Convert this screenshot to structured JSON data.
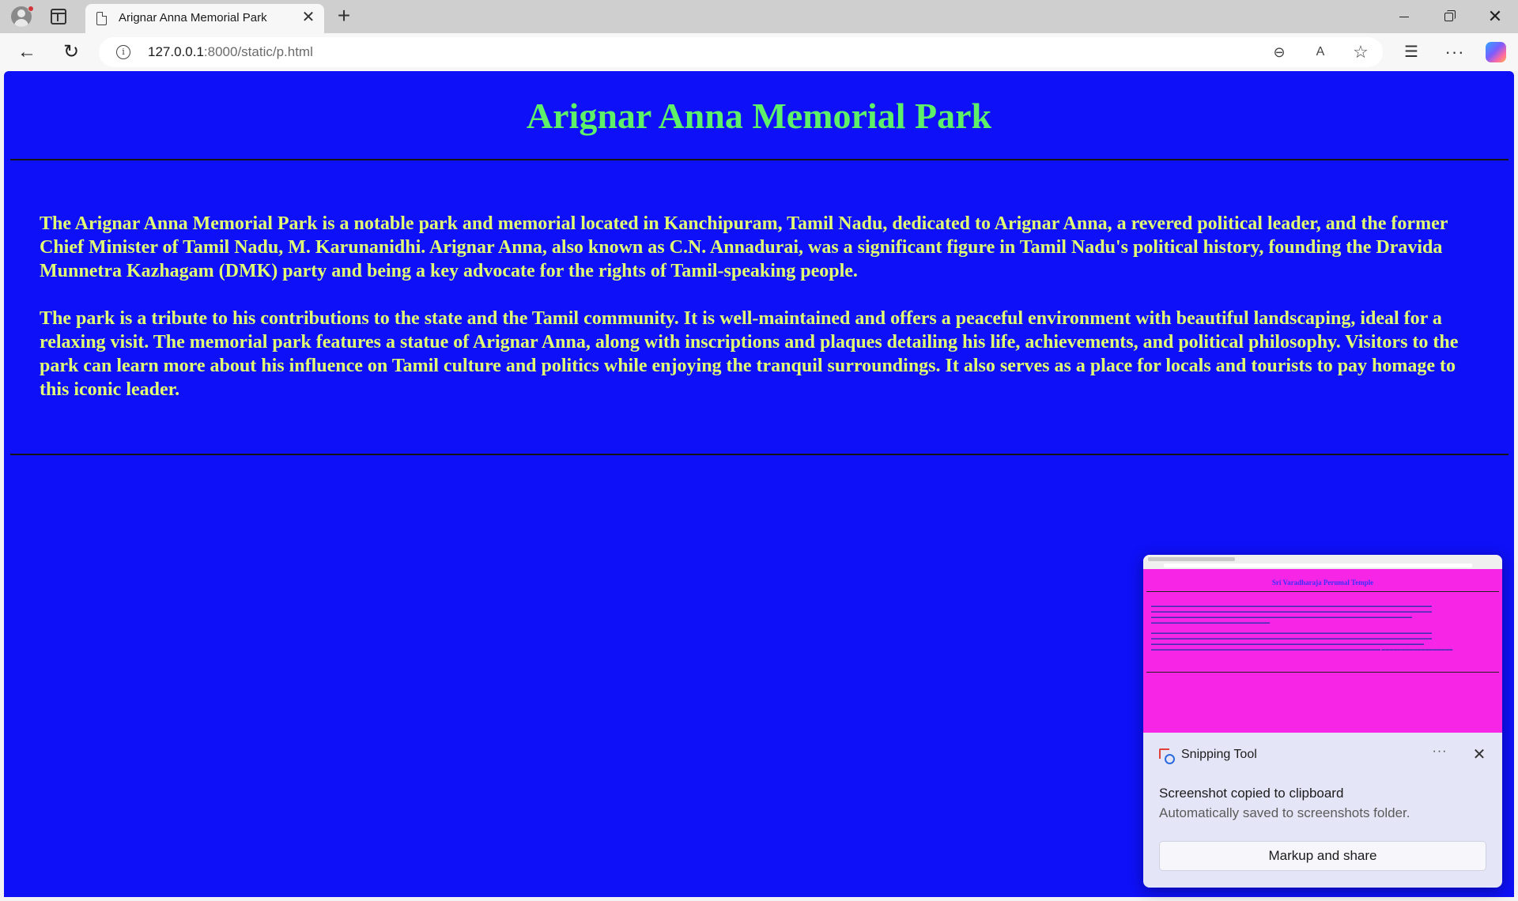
{
  "browser": {
    "tab": {
      "title": "Arignar Anna Memorial Park",
      "close": "✕"
    },
    "new_tab": "+",
    "url": {
      "host": "127.0.0.1",
      "path": ":8000/static/p.html"
    },
    "window_controls": {
      "close": "✕"
    }
  },
  "page": {
    "title": "Arignar Anna Memorial Park",
    "paragraphs": [
      "The Arignar Anna Memorial Park is a notable park and memorial located in Kanchipuram, Tamil Nadu, dedicated to Arignar Anna, a revered political leader, and the former Chief Minister of Tamil Nadu, M. Karunanidhi. Arignar Anna, also known as C.N. Annadurai, was a significant figure in Tamil Nadu's political history, founding the Dravida Munnetra Kazhagam (DMK) party and being a key advocate for the rights of Tamil-speaking people.",
      "The park is a tribute to his contributions to the state and the Tamil community. It is well-maintained and offers a peaceful environment with beautiful landscaping, ideal for a relaxing visit. The memorial park features a statue of Arignar Anna, along with inscriptions and plaques detailing his life, achievements, and political philosophy. Visitors to the park can learn more about his influence on Tamil culture and politics while enjoying the tranquil surroundings. It also serves as a place for locals and tourists to pay homage to this iconic leader."
    ],
    "background_color": "#0e10f7",
    "title_color": "#5ff06a",
    "text_color": "#e2ff74"
  },
  "toast": {
    "app_name": "Snipping Tool",
    "more": "···",
    "close": "✕",
    "heading": "Screenshot copied to clipboard",
    "subtext": "Automatically saved to screenshots folder.",
    "button_label": "Markup and share",
    "thumbnail": {
      "title": "Sri Varadharaja Perumal Temple",
      "background_color": "#f726e6"
    }
  },
  "icons": {
    "back": "←",
    "reload": "↻",
    "zoom": "⊖",
    "read_aloud": "A",
    "favorite": "☆",
    "favorites": "☰",
    "more": "···"
  }
}
